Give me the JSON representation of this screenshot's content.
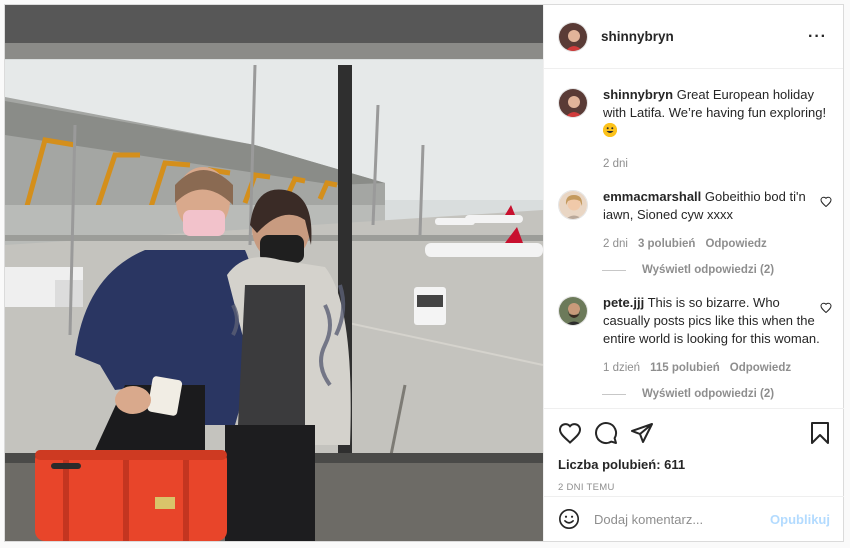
{
  "post": {
    "username": "shinnybryn",
    "caption": "Great European holiday with Latifa. We’re having fun exploring!",
    "caption_emoji": "grinning-face-emoji",
    "caption_time": "2 dni"
  },
  "comments": [
    {
      "username": "emmacmarshall",
      "text": "Gobeithio bod ti'n iawn, Sioned cyw xxxx",
      "time": "2 dni",
      "likes": "3 polubień",
      "reply": "Odpowiedz",
      "view_replies": "Wyświetl odpowiedzi (2)"
    },
    {
      "username": "pete.jjj",
      "text": "This is so bizarre. Who casually posts pics like this when the entire world is looking for this woman.",
      "time": "1 dzień",
      "likes": "115 polubień",
      "reply": "Odpowiedz",
      "view_replies": "Wyświetl odpowiedzi (2)"
    }
  ],
  "footer": {
    "likes_label": "Liczba polubień: 611",
    "date_label": "2 DNI TEMU",
    "comment_placeholder": "Dodaj komentarz...",
    "post_button": "Opublikuj"
  },
  "icons": {
    "like": "heart-icon",
    "comment": "comment-icon",
    "share": "share-icon",
    "save": "bookmark-icon",
    "more": "more-options-icon",
    "emoji": "emoji-smile-icon"
  }
}
